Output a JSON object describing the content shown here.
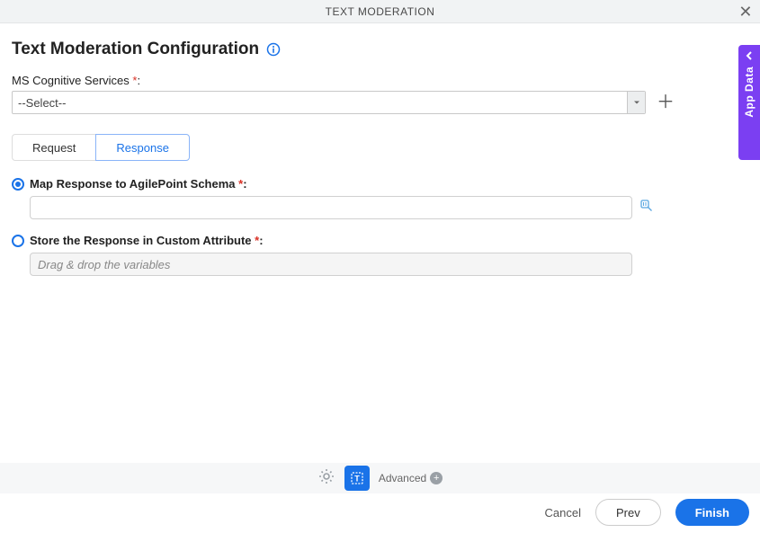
{
  "dialog": {
    "title": "TEXT MODERATION"
  },
  "page": {
    "title": "Text Moderation Configuration"
  },
  "fields": {
    "cognitive_label": "MS Cognitive Services",
    "select_value": "--Select--"
  },
  "tabs": {
    "request": "Request",
    "response": "Response"
  },
  "options": {
    "map_label": "Map Response to AgilePoint Schema",
    "store_label": "Store the Response in Custom Attribute",
    "store_placeholder": "Drag & drop the variables"
  },
  "footer": {
    "advanced": "Advanced"
  },
  "actions": {
    "cancel": "Cancel",
    "prev": "Prev",
    "finish": "Finish"
  },
  "side": {
    "label": "App Data"
  },
  "symbols": {
    "required": " *",
    "colon": ":"
  }
}
